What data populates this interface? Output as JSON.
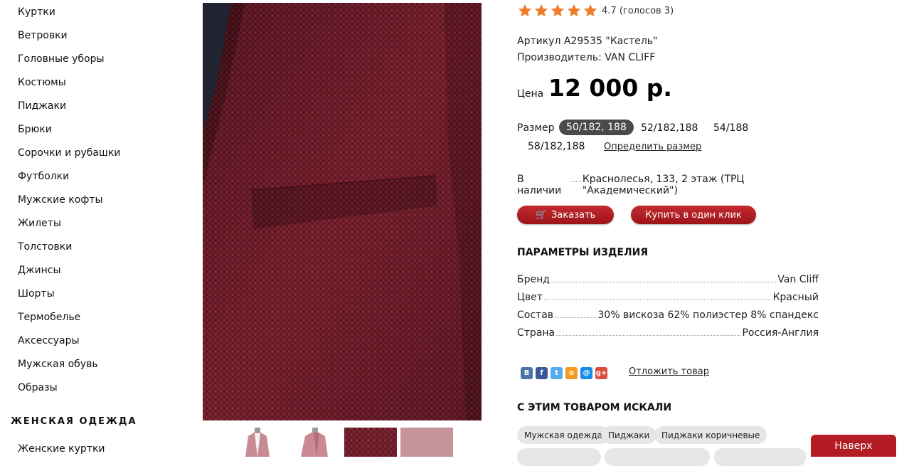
{
  "sidebar": {
    "items": [
      {
        "label": "Куртки"
      },
      {
        "label": "Ветровки"
      },
      {
        "label": "Головные уборы"
      },
      {
        "label": "Костюмы"
      },
      {
        "label": "Пиджаки"
      },
      {
        "label": "Брюки"
      },
      {
        "label": "Сорочки и рубашки"
      },
      {
        "label": "Футболки"
      },
      {
        "label": "Мужские кофты"
      },
      {
        "label": "Жилеты"
      },
      {
        "label": "Толстовки"
      },
      {
        "label": "Джинсы"
      },
      {
        "label": "Шорты"
      },
      {
        "label": "Термобелье"
      },
      {
        "label": "Аксессуары"
      },
      {
        "label": "Мужская обувь"
      },
      {
        "label": "Образы"
      }
    ],
    "womens_section": {
      "title": "ЖЕНСКАЯ ОДЕЖДА",
      "first_item": "Женские куртки"
    }
  },
  "product": {
    "rating": {
      "stars": 5,
      "value": "4.7",
      "votes_text": "(голосов 3)"
    },
    "article": "Артикул A29535 \"Кастель\"",
    "manufacturer": "Производитель: VAN CLIFF",
    "price_label": "Цена",
    "price": "12 000 р.",
    "size_label": "Размер",
    "sizes": [
      "50/182, 188",
      "52/182,188",
      "54/188",
      "58/182,188"
    ],
    "selected_size": "50/182, 188",
    "size_help": "Определить размер",
    "stock_label": "В наличии",
    "stock_location": "Краснолесья, 133, 2 этаж (ТРЦ \"Академический\")",
    "order_button": "Заказать",
    "one_click_button": "Купить в один клик",
    "params_title": "ПАРАМЕТРЫ ИЗДЕЛИЯ",
    "params": [
      {
        "name": "Бренд",
        "value": "Van Cliff"
      },
      {
        "name": "Цвет",
        "value": "Красный"
      },
      {
        "name": "Состав",
        "value": "30% вискоза 62% полиэстер 8% спандекс"
      },
      {
        "name": "Страна",
        "value": "Россия-Англия"
      }
    ],
    "postpone": "Отложить товар",
    "related_title": "С ЭТИМ ТОВАРОМ ИСКАЛИ",
    "related_tags": [
      "Мужская одежда",
      "Пиджаки",
      "Пиджаки коричневые"
    ]
  },
  "social_icons": [
    {
      "name": "vk-icon",
      "glyph": "B",
      "color": "#4c75a3"
    },
    {
      "name": "facebook-icon",
      "glyph": "f",
      "color": "#3b5998"
    },
    {
      "name": "twitter-icon",
      "glyph": "t",
      "color": "#55acee"
    },
    {
      "name": "odnoklassniki-icon",
      "glyph": "о",
      "color": "#f59a23"
    },
    {
      "name": "mailru-icon",
      "glyph": "@",
      "color": "#168de2"
    },
    {
      "name": "googleplus-icon",
      "glyph": "g+",
      "color": "#dd4b39"
    }
  ],
  "colors": {
    "accent": "#b31c22",
    "star": "#f07c2a",
    "selected_size_bg": "#4a4a4a"
  },
  "back_to_top": "Наверх"
}
